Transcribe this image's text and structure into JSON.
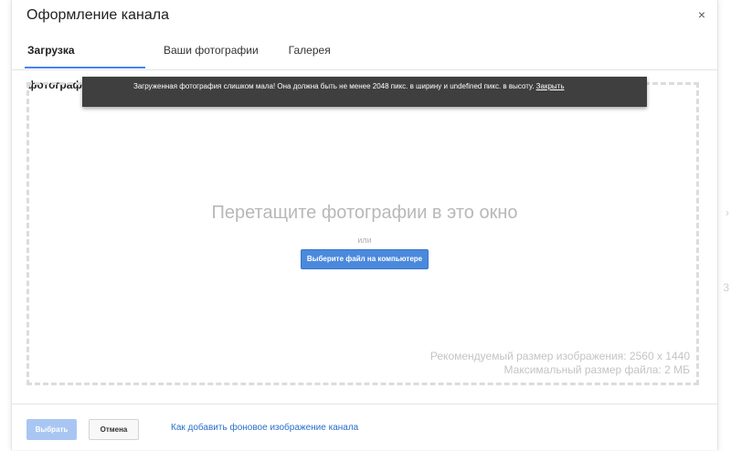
{
  "backdrop": {
    "right_glyph_1": "›",
    "right_glyph_2": "3"
  },
  "dialog": {
    "title": "Оформление канала",
    "close_symbol": "×"
  },
  "tabs": [
    {
      "label": "Загрузка фотографий",
      "active": true
    },
    {
      "label": "Ваши фотографии",
      "active": false
    },
    {
      "label": "Галерея",
      "active": false
    }
  ],
  "toast": {
    "message": "Загруженная фотография слишком мала! Она должна быть не менее 2048 пикс. в ширину и undefined пикс. в высоту.",
    "link": "Закрыть"
  },
  "dropzone": {
    "title": "Перетащите фотографии в это окно",
    "or": "или",
    "choose_button": "Выберите файл на компьютере",
    "recommended_size": "Рекомендуемый размер изображения: 2560 x 1440",
    "max_size": "Максимальный размер файла: 2 МБ"
  },
  "footer": {
    "select_button": "Выбрать",
    "cancel_button": "Отмена",
    "help_link": "Как добавить фоновое изображение канала"
  },
  "colors": {
    "accent": "#4285f4",
    "button_primary": "#4a89dc",
    "button_disabled": "#a9c6f3",
    "toast_bg": "#3f3f3f",
    "link": "#2a6fc9"
  }
}
